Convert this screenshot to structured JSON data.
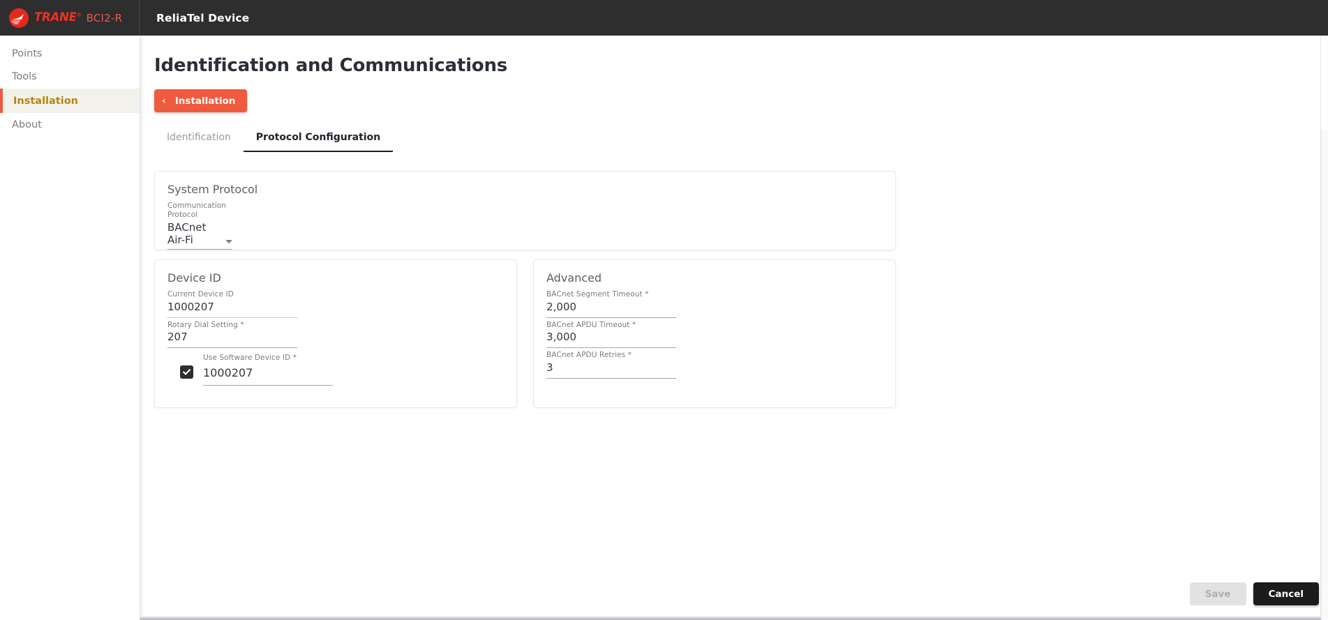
{
  "topbar": {
    "brand_name": "TRANE",
    "brand_reg": "®",
    "brand_model": "BCI2-R",
    "device_title": "ReliaTel Device",
    "logo_icon": "trane-circle-logo",
    "colors": {
      "bar": "#2e2e2e",
      "brand_red": "#ee3124",
      "model_red": "#e8594c"
    }
  },
  "sidebar": {
    "items": [
      {
        "label": "Points",
        "active": false
      },
      {
        "label": "Tools",
        "active": false
      },
      {
        "label": "Installation",
        "active": true
      },
      {
        "label": "About",
        "active": false
      }
    ],
    "active_color": "#b8860b",
    "active_bg": "#f3f1ec",
    "active_bar": "#ef5b42"
  },
  "main": {
    "page_title": "Identification and Communications",
    "back_button": {
      "label": "Installation",
      "icon": "chevron-left-icon",
      "color": "#f05a3f"
    },
    "tabs": [
      {
        "label": "Identification",
        "active": false
      },
      {
        "label": "Protocol Configuration",
        "active": true
      }
    ],
    "cards": {
      "system_protocol": {
        "title": "System Protocol",
        "fields": [
          {
            "label": "Communication Protocol",
            "value": "BACnet Air-Fi",
            "required": false,
            "type": "select",
            "disabled": false,
            "icon": "chevron-down-icon"
          }
        ]
      },
      "device_id": {
        "title": "Device ID",
        "fields": [
          {
            "label": "Current Device ID",
            "value": "1000207",
            "required": false,
            "type": "text",
            "disabled": true
          },
          {
            "label": "Rotary Dial Setting",
            "value": "207",
            "required": true,
            "type": "text",
            "disabled": false
          },
          {
            "label": "Use Software Device ID",
            "value": "1000207",
            "required": true,
            "type": "checkbox-text",
            "checked": true,
            "checkbox_icon": "check-icon"
          }
        ]
      },
      "advanced": {
        "title": "Advanced",
        "fields": [
          {
            "label": "BACnet Segment Timeout",
            "value": "2,000",
            "required": true,
            "type": "text",
            "disabled": false
          },
          {
            "label": "BACnet APDU Timeout",
            "value": "3,000",
            "required": true,
            "type": "text",
            "disabled": false
          },
          {
            "label": "BACnet APDU Retries",
            "value": "3",
            "required": true,
            "type": "text",
            "disabled": false
          }
        ]
      }
    }
  },
  "footer": {
    "save_label": "Save",
    "save_disabled": true,
    "cancel_label": "Cancel"
  },
  "symbols": {
    "required_mark": "*",
    "chevron_left": "‹"
  }
}
